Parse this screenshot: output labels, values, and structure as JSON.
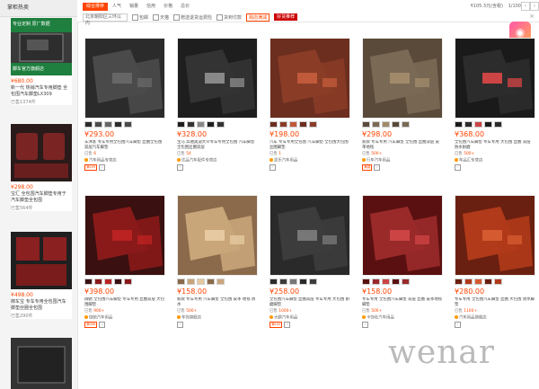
{
  "sidebar": {
    "header": "掌柜热卖",
    "items": [
      {
        "price": "¥680.00",
        "title": "新一代 热销汽车专用脚垫 全包围汽车脚垫LX309",
        "sales": "已售1374件"
      },
      {
        "price": "¥298.00",
        "title": "宝汇 全包围汽车脚垫专用于 汽车脚垫全包围",
        "sales": "已售564件"
      },
      {
        "price": "¥498.00",
        "title": "御车宝 专车专用全包围汽车 脚垫丝圈全包围",
        "sales": "已售290件"
      },
      {
        "price": "",
        "title": "",
        "sales": ""
      }
    ],
    "banner_text": "专业定制 原厂数据",
    "banner_sub": "脚车官方旗舰店"
  },
  "topbar": {
    "tabs": [
      "综合排序",
      "人气",
      "销量",
      "信用",
      "价格",
      "总价"
    ],
    "active_tab": "综合排序",
    "page": "1/100",
    "price_text": "¥105.3元(含税)",
    "location": "北京朝阳区三环以内",
    "filters": [
      "包邮",
      "天猫",
      "赠送退货运费险",
      "货到付款"
    ],
    "promo": "跨店满减",
    "promo2": "好货推荐"
  },
  "products": [
    {
      "price": "¥293.00",
      "title": "车沐客 专车专用全包围汽车脚垫 丝圈全包围双层汽车脚垫",
      "kw": "汽车脚垫",
      "sales": "6",
      "shop": "汽车用品专营店",
      "badge": "满299"
    },
    {
      "price": "¥328.00",
      "title": "宝马 奔驰奥迪大众专车专用全包围 汽车脚垫全包围丝圈双层",
      "kw": "汽车脚垫",
      "sales": "54",
      "shop": "优品汽车配件专营店",
      "badge": ""
    },
    {
      "price": "¥198.00",
      "title": "汽车 专车专用全包围 汽车脚垫 全包围大包围丝圈脚垫",
      "kw": "汽车脚垫",
      "sales": "1",
      "shop": "途乐汽车用品",
      "badge": ""
    },
    {
      "price": "¥298.00",
      "title": "新款 专车专用 汽车脚垫 全包围 丝圈双层 皮革地毯",
      "kw": "汽车脚垫",
      "sales": "500+",
      "shop": "行车汽车用品",
      "badge": "满减"
    },
    {
      "price": "¥368.00",
      "title": "全包围汽车脚垫 专车专用 大包围 丝圈 双层 防水耐磨",
      "kw": "汽车脚垫",
      "sales": "500+",
      "shop": "车品汇专营店",
      "badge": ""
    },
    {
      "price": "¥398.00",
      "title": "御驰 全包围汽车脚垫 专车专用 丝圈双层 大包围脚垫",
      "kw": "汽车脚垫",
      "sales": "900+",
      "shop": "御驰汽车用品",
      "badge": "满398"
    },
    {
      "price": "¥158.00",
      "title": "新款 专车专用 汽车脚垫 全包围 皮革 地毯 防水",
      "kw": "汽车脚垫",
      "sales": "500+",
      "shop": "车饰旗舰店",
      "badge": ""
    },
    {
      "price": "¥258.00",
      "title": "全包围汽车脚垫 丝圈双层 专车专用 大包围 耐磨脚垫",
      "kw": "汽车脚垫",
      "sales": "1000+",
      "shop": "大鹏汽车用品",
      "badge": "满100"
    },
    {
      "price": "¥158.00",
      "title": "专车专用 全包围汽车脚垫 双层 丝圈 皮革地毯脚垫",
      "kw": "汽车脚垫",
      "sales": "500+",
      "shop": "卡饰社汽车用品",
      "badge": ""
    },
    {
      "price": "¥280.00",
      "title": "专车专用 全包围汽车脚垫 丝圈 大包围 防水脚垫",
      "kw": "汽车脚垫",
      "sales": "1100+",
      "shop": "汽车用品旗舰店",
      "badge": ""
    }
  ],
  "watermark": "wenar",
  "colors": {
    "accent": "#ff4400"
  }
}
